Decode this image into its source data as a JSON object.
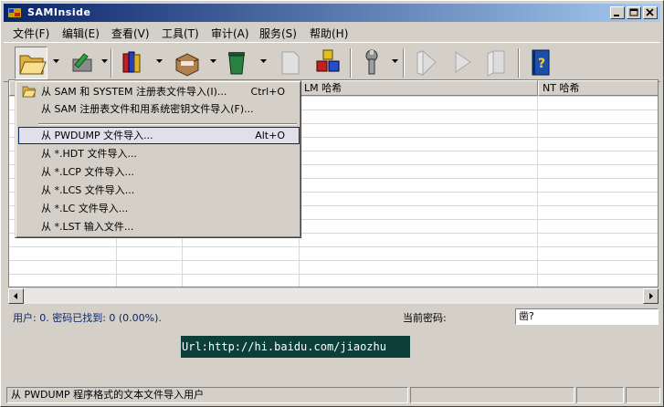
{
  "window": {
    "title": "SAMInside"
  },
  "menubar": [
    "文件(F)",
    "编辑(E)",
    "查看(V)",
    "工具(T)",
    "审计(A)",
    "服务(S)",
    "帮助(H)"
  ],
  "table": {
    "headers": [
      "",
      "",
      "",
      "LM 哈希",
      "NT 哈希"
    ]
  },
  "import_menu": {
    "items": [
      {
        "label": "从 SAM 和 SYSTEM 注册表文件导入(I)...",
        "shortcut": "Ctrl+O"
      },
      {
        "label": "从 SAM 注册表文件和用系统密钥文件导入(F)...",
        "shortcut": ""
      },
      {
        "label": "从 PWDUMP 文件导入...",
        "shortcut": "Alt+O"
      },
      {
        "label": "从 *.HDT 文件导入...",
        "shortcut": ""
      },
      {
        "label": "从 *.LCP 文件导入...",
        "shortcut": ""
      },
      {
        "label": "从 *.LCS 文件导入...",
        "shortcut": ""
      },
      {
        "label": "从 *.LC 文件导入...",
        "shortcut": ""
      },
      {
        "label": "从 *.LST 输入文件...",
        "shortcut": ""
      }
    ]
  },
  "info": {
    "users_text": "用户: 0. 密码已找到: 0 (0.00%).",
    "current_password_label": "当前密码:",
    "current_password_value": "凿?"
  },
  "banner": {
    "url_text": "Url:http://hi.baidu.com/jiaozhu"
  },
  "statusbar": {
    "message": "从 PWDUMP 程序格式的文本文件导入用户"
  },
  "colors": {
    "titlebar_start": "#0a246a",
    "titlebar_end": "#a6caf0",
    "banner_bg": "#0d3f3a",
    "info_text": "#0a246a"
  }
}
